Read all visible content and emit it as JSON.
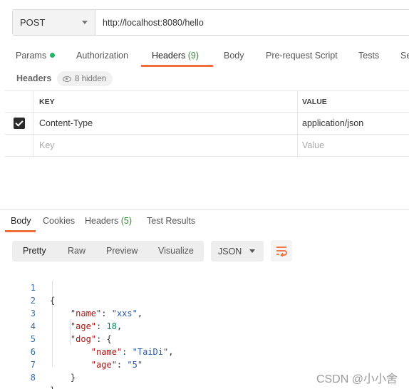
{
  "request": {
    "method": "POST",
    "url": "http://localhost:8080/hello"
  },
  "request_tabs": [
    {
      "label": "Params"
    },
    {
      "label": "Authorization"
    },
    {
      "label": "Headers",
      "count": "(9)"
    },
    {
      "label": "Body"
    },
    {
      "label": "Pre-request Script"
    },
    {
      "label": "Tests"
    },
    {
      "label": "Se"
    }
  ],
  "headers_section": {
    "label": "Headers",
    "hidden_badge": "8 hidden"
  },
  "headers_table": {
    "col_key": "KEY",
    "col_value": "VALUE",
    "rows": [
      {
        "key": "Content-Type",
        "value": "application/json",
        "checked": true
      }
    ],
    "placeholder_key": "Key",
    "placeholder_value": "Value"
  },
  "response_tabs": [
    {
      "label": "Body"
    },
    {
      "label": "Cookies"
    },
    {
      "label": "Headers",
      "count": "(5)"
    },
    {
      "label": "Test Results"
    }
  ],
  "view_modes": [
    "Pretty",
    "Raw",
    "Preview",
    "Visualize"
  ],
  "format": "JSON",
  "code_line_numbers": [
    "1",
    "2",
    "3",
    "4",
    "5",
    "6",
    "7",
    "8"
  ],
  "response_json": {
    "name": "xxs",
    "age": "18",
    "dog_key": "dog",
    "dog_name": "TaiDi",
    "dog_age": "5"
  },
  "watermark": "CSDN @小小舍",
  "colors": {
    "accent": "#f26b3a",
    "count_green": "#2f8f2f",
    "params_dot": "#26b36a"
  }
}
